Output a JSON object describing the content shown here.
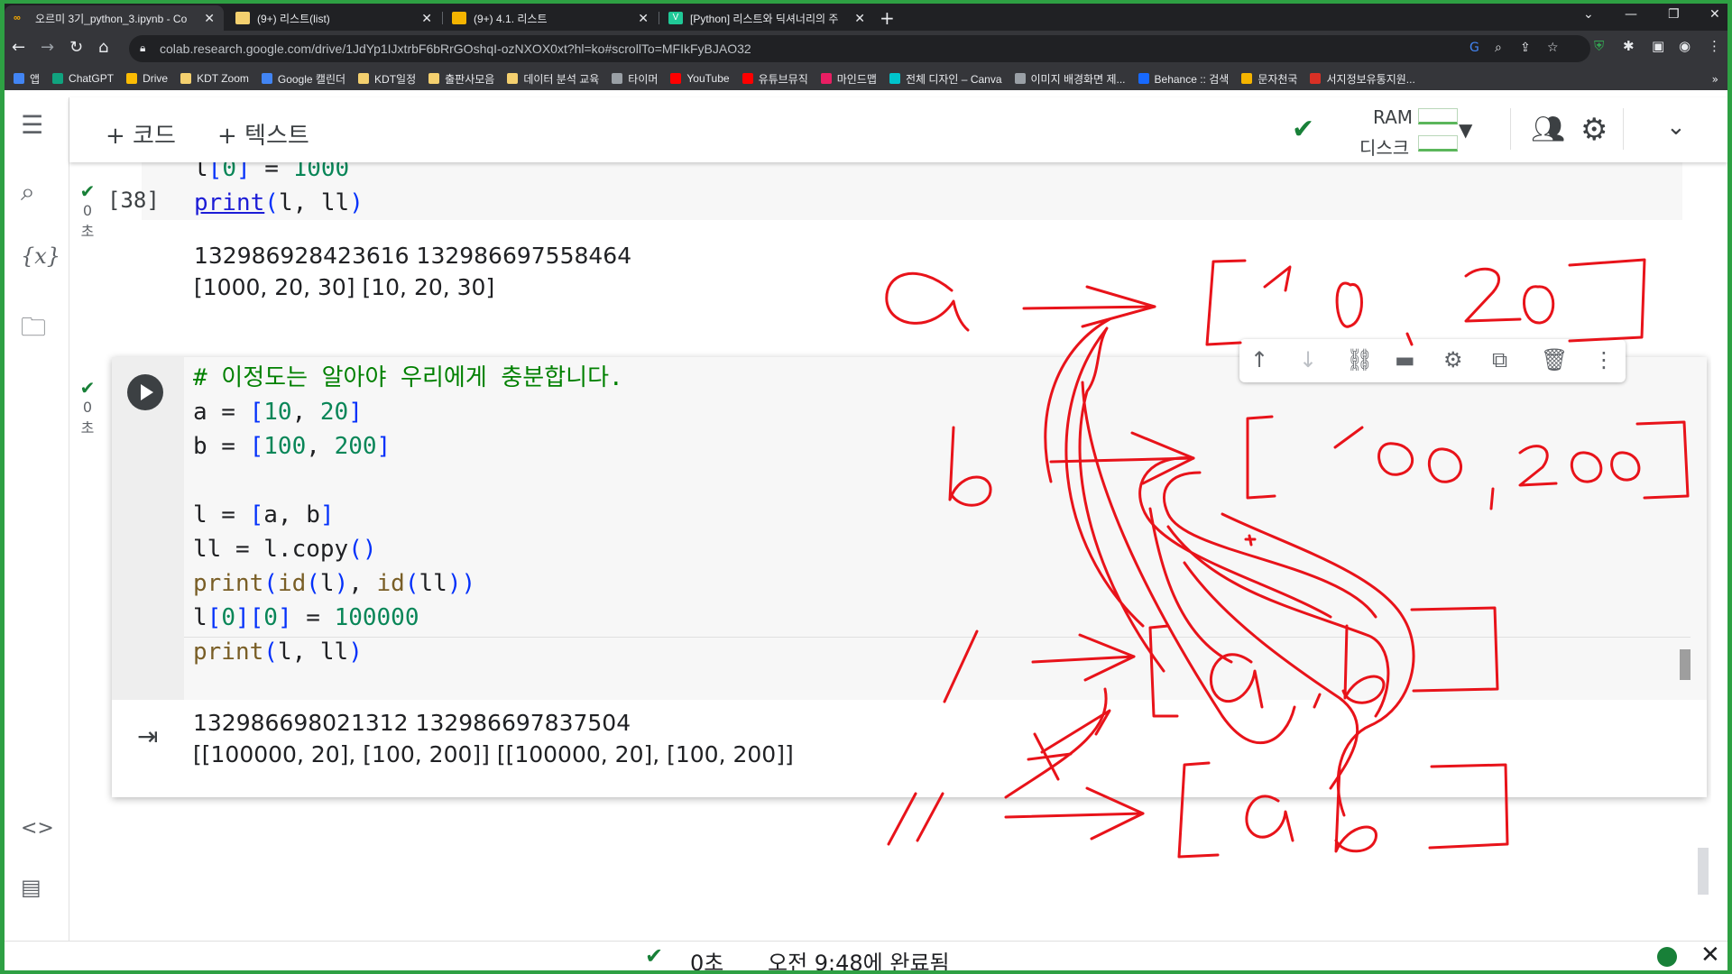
{
  "tabs": [
    {
      "title": "오르미 3기_python_3.ipynb - Co",
      "active": true,
      "icon_color": "#f9ab00",
      "icon": "colab-icon"
    },
    {
      "title": "(9+) 리스트(list)",
      "active": false,
      "icon_color": "#f4d06f",
      "icon": "notebook-icon"
    },
    {
      "title": "(9+) 4.1. 리스트",
      "active": false,
      "icon_color": "#f4b400",
      "icon": "book-icon"
    },
    {
      "title": "[Python] 리스트와 딕셔너리의 주",
      "active": false,
      "icon_color": "#20c997",
      "icon": "velog-icon"
    }
  ],
  "address": {
    "url": "colab.research.google.com/drive/1JdYp1IJxtrbF6bRrGOshqI-ozNXOX0xt?hl=ko#scrollTo=MFIkFyBJAO32"
  },
  "bookmarks": [
    {
      "label": "앱",
      "color": "#4285f4"
    },
    {
      "label": "ChatGPT",
      "color": "#10a37f"
    },
    {
      "label": "Drive",
      "color": "#fbbc04"
    },
    {
      "label": "KDT Zoom",
      "color": "#f4d06f"
    },
    {
      "label": "Google 캘린더",
      "color": "#4285f4"
    },
    {
      "label": "KDT일정",
      "color": "#f4d06f"
    },
    {
      "label": "출판사모음",
      "color": "#f4d06f"
    },
    {
      "label": "데이터 분석 교육",
      "color": "#f4d06f"
    },
    {
      "label": "타이머",
      "color": "#9aa0a6"
    },
    {
      "label": "YouTube",
      "color": "#ff0000"
    },
    {
      "label": "유튜브뮤직",
      "color": "#ff0000"
    },
    {
      "label": "마인드맵",
      "color": "#e91e63"
    },
    {
      "label": "전체 디자인 – Canva",
      "color": "#00c4cc"
    },
    {
      "label": "이미지 배경화면 제...",
      "color": "#9aa0a6"
    },
    {
      "label": "Behance :: 검색",
      "color": "#1769ff"
    },
    {
      "label": "문자천국",
      "color": "#f4b400"
    },
    {
      "label": "서지정보유통지원...",
      "color": "#d93025"
    }
  ],
  "bookmarks_more": "»",
  "toolbar": {
    "add_code": "+ 코드",
    "add_text": "+ 텍스트",
    "ram_label": "RAM",
    "disk_label": "디스크"
  },
  "cell1": {
    "exec_count": "[38]",
    "exec_time": "0초",
    "output_lines": [
      "132986928423616 132986697558464",
      "[1000, 20, 30] [10, 20, 30]"
    ]
  },
  "cell2": {
    "exec_time": "0초",
    "output_lines": [
      "132986698021312 132986697837504",
      "[[100000, 20], [100, 200]] [[100000, 20], [100, 200]]"
    ]
  },
  "status": {
    "time": "0초",
    "message": "오전 9:48에 완료됨"
  },
  "colors": {
    "ink": "#e8131a",
    "frame": "#2ea043",
    "chrome_dark": "#202124",
    "check_green": "#188038"
  }
}
